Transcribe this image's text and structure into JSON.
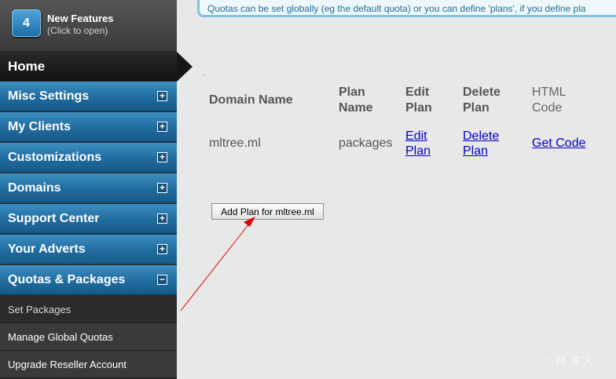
{
  "features": {
    "count": "4",
    "title": "New Features",
    "subtitle": "(Click to open)"
  },
  "sidebar": {
    "home": "Home",
    "items": [
      {
        "label": "Misc Settings",
        "toggle": "+"
      },
      {
        "label": "My Clients",
        "toggle": "+"
      },
      {
        "label": "Customizations",
        "toggle": "+"
      },
      {
        "label": "Domains",
        "toggle": "+"
      },
      {
        "label": "Support Center",
        "toggle": "+"
      },
      {
        "label": "Your Adverts",
        "toggle": "+"
      },
      {
        "label": "Quotas & Packages",
        "toggle": "−"
      }
    ],
    "subitems": [
      "Set Packages",
      "Manage Global Quotas",
      "Upgrade Reseller Account"
    ]
  },
  "notice": "Quotas can be set globally (eg the default quota) or you can define 'plans', if you define pla",
  "table": {
    "headers": {
      "domain": "Domain Name",
      "plan_name_1": "Plan",
      "plan_name_2": "Name",
      "edit_1": "Edit",
      "edit_2": "Plan",
      "delete_1": "Delete",
      "delete_2": "Plan",
      "html_1": "HTML",
      "html_2": "Code"
    },
    "row": {
      "domain": "mltree.ml",
      "plan": "packages",
      "edit_1": "Edit",
      "edit_2": "Plan",
      "delete_1": "Delete",
      "delete_2": "Plan",
      "get_code": "Get Code"
    }
  },
  "add_button": "Add Plan for mltree.ml",
  "watermark": "小糖博客",
  "colors": {
    "annotation_arrow": "#e00000",
    "link": "#0000cc",
    "menu_blue": "#206b9e"
  }
}
